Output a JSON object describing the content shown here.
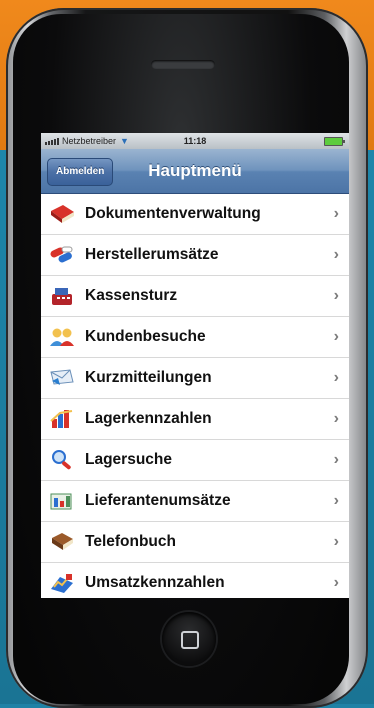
{
  "status_bar": {
    "carrier": "Netzbetreiber",
    "time": "11:18"
  },
  "nav": {
    "back_button": "Abmelden",
    "title": "Hauptmenü"
  },
  "menu_items": [
    {
      "label": "Dokumentenverwaltung",
      "icon": "book-icon"
    },
    {
      "label": "Herstellerumsätze",
      "icon": "pills-icon"
    },
    {
      "label": "Kassensturz",
      "icon": "cash-register-icon"
    },
    {
      "label": "Kundenbesuche",
      "icon": "people-icon"
    },
    {
      "label": "Kurzmitteilungen",
      "icon": "message-icon"
    },
    {
      "label": "Lagerkennzahlen",
      "icon": "chart-icon"
    },
    {
      "label": "Lagersuche",
      "icon": "magnifier-icon"
    },
    {
      "label": "Lieferantenumsätze",
      "icon": "supplier-icon"
    },
    {
      "label": "Telefonbuch",
      "icon": "phonebook-icon"
    },
    {
      "label": "Umsatzkennzahlen",
      "icon": "sales-chart-icon"
    }
  ],
  "colors": {
    "nav_bar": "#5a82b2",
    "background_top": "#f0891c",
    "background_bottom": "#1d86aa"
  }
}
